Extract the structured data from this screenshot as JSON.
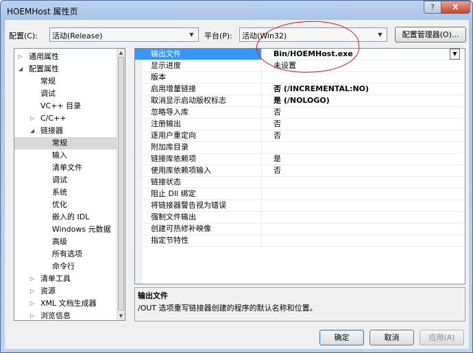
{
  "window": {
    "title": "HOEMHost 属性页",
    "help": "?",
    "close": "X"
  },
  "config": {
    "label": "配置(C):",
    "value": "活动(Release)"
  },
  "platform": {
    "label": "平台(P):",
    "value": "活动(Win32)"
  },
  "config_manager_label": "配置管理器(O)...",
  "tree": [
    {
      "label": "通用属性",
      "indent": 0,
      "expander": "▷"
    },
    {
      "label": "配置属性",
      "indent": 0,
      "expander": "◢"
    },
    {
      "label": "常规",
      "indent": 1,
      "expander": ""
    },
    {
      "label": "调试",
      "indent": 1,
      "expander": ""
    },
    {
      "label": "VC++ 目录",
      "indent": 1,
      "expander": ""
    },
    {
      "label": "C/C++",
      "indent": 1,
      "expander": "▷"
    },
    {
      "label": "链接器",
      "indent": 1,
      "expander": "◢"
    },
    {
      "label": "常规",
      "indent": 2,
      "expander": "",
      "selected": true
    },
    {
      "label": "输入",
      "indent": 2,
      "expander": ""
    },
    {
      "label": "清单文件",
      "indent": 2,
      "expander": ""
    },
    {
      "label": "调试",
      "indent": 2,
      "expander": ""
    },
    {
      "label": "系统",
      "indent": 2,
      "expander": ""
    },
    {
      "label": "优化",
      "indent": 2,
      "expander": ""
    },
    {
      "label": "嵌入的 IDL",
      "indent": 2,
      "expander": ""
    },
    {
      "label": "Windows 元数据",
      "indent": 2,
      "expander": ""
    },
    {
      "label": "高级",
      "indent": 2,
      "expander": ""
    },
    {
      "label": "所有选项",
      "indent": 2,
      "expander": ""
    },
    {
      "label": "命令行",
      "indent": 2,
      "expander": ""
    },
    {
      "label": "清单工具",
      "indent": 1,
      "expander": "▷"
    },
    {
      "label": "资源",
      "indent": 1,
      "expander": "▷"
    },
    {
      "label": "XML 文档生成器",
      "indent": 1,
      "expander": "▷"
    },
    {
      "label": "浏览信息",
      "indent": 1,
      "expander": "▷"
    }
  ],
  "properties": [
    {
      "name": "输出文件",
      "value": "Bin/HOEMHost.exe",
      "bold": true,
      "selected": true
    },
    {
      "name": "显示进度",
      "value": "未设置",
      "bold": false
    },
    {
      "name": "版本",
      "value": "",
      "bold": false
    },
    {
      "name": "启用增量链接",
      "value": "否 (/INCREMENTAL:NO)",
      "bold": true
    },
    {
      "name": "取消显示启动版权标志",
      "value": "是 (/NOLOGO)",
      "bold": true
    },
    {
      "name": "忽略导入库",
      "value": "否",
      "bold": false
    },
    {
      "name": "注册输出",
      "value": "否",
      "bold": false
    },
    {
      "name": "逐用户重定向",
      "value": "否",
      "bold": false
    },
    {
      "name": "附加库目录",
      "value": "",
      "bold": false
    },
    {
      "name": "链接库依赖项",
      "value": "是",
      "bold": false
    },
    {
      "name": "使用库依赖项输入",
      "value": "否",
      "bold": false
    },
    {
      "name": "链接状态",
      "value": "",
      "bold": false
    },
    {
      "name": "阻止 Dll 绑定",
      "value": "",
      "bold": false
    },
    {
      "name": "将链接器警告视为错误",
      "value": "",
      "bold": false
    },
    {
      "name": "强制文件输出",
      "value": "",
      "bold": false
    },
    {
      "name": "创建可热修补映像",
      "value": "",
      "bold": false
    },
    {
      "name": "指定节特性",
      "value": "",
      "bold": false
    }
  ],
  "description": {
    "title": "输出文件",
    "text": "/OUT 选项重写链接器创建的程序的默认名称和位置。"
  },
  "buttons": {
    "ok": "确定",
    "cancel": "取消",
    "apply": "应用(A)"
  },
  "colors": {
    "selection": "#3399ff",
    "annotation": "#e01010"
  }
}
